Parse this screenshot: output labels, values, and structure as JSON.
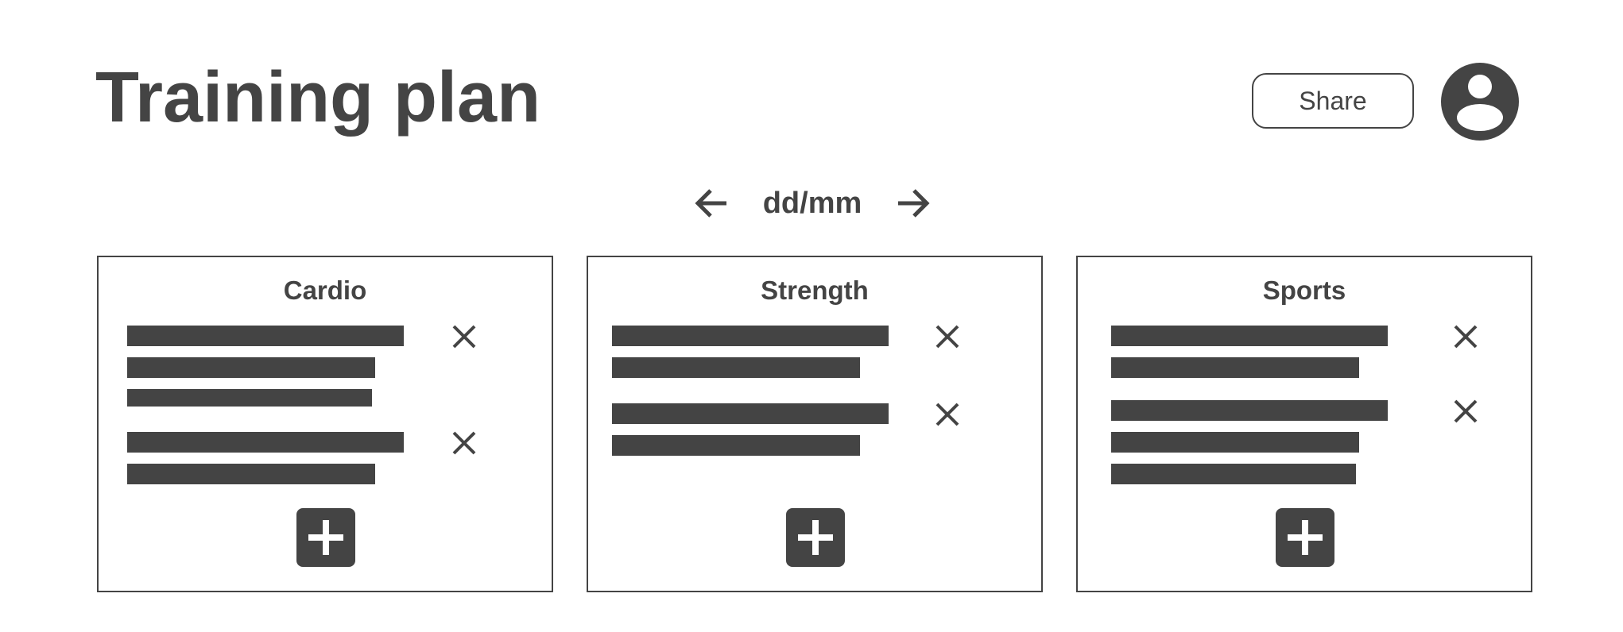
{
  "header": {
    "title": "Training plan",
    "share_label": "Share",
    "avatar_icon": "user-avatar-icon"
  },
  "date_nav": {
    "date_label": "dd/mm",
    "prev_icon": "arrow-left-icon",
    "next_icon": "arrow-right-icon"
  },
  "cards": [
    {
      "title": "Cardio",
      "items": [
        {
          "lines": 3,
          "remove_icon": "close-icon"
        },
        {
          "lines": 2,
          "remove_icon": "close-icon"
        }
      ],
      "add_icon": "plus-icon"
    },
    {
      "title": "Strength",
      "items": [
        {
          "lines": 2,
          "remove_icon": "close-icon"
        },
        {
          "lines": 2,
          "remove_icon": "close-icon"
        }
      ],
      "add_icon": "plus-icon"
    },
    {
      "title": "Sports",
      "items": [
        {
          "lines": 2,
          "remove_icon": "close-icon"
        },
        {
          "lines": 3,
          "remove_icon": "close-icon"
        }
      ],
      "add_icon": "plus-icon"
    }
  ],
  "colors": {
    "ink": "#444444",
    "background": "#ffffff"
  }
}
